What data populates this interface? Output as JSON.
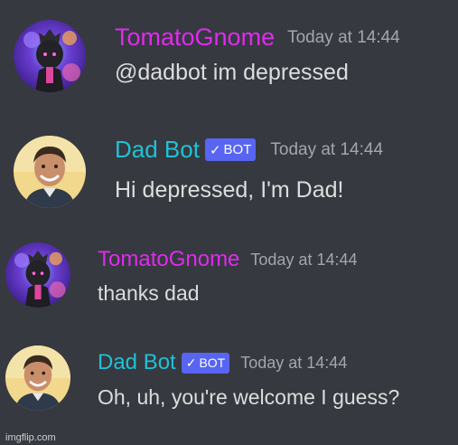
{
  "colors": {
    "background": "#36393f",
    "tomato_name": "#e02af0",
    "dadbot_name": "#1fc2d6",
    "bot_badge": "#5865f2",
    "timestamp": "#a3a6aa",
    "message_text": "#dcddde"
  },
  "messages": [
    {
      "author": "TomatoGnome",
      "timestamp": "Today at 14:44",
      "text": "@dadbot im depressed",
      "avatar_icon": "dark-character-avatar"
    },
    {
      "author": "Dad Bot",
      "badge": "BOT",
      "badge_icon": "checkmark-icon",
      "timestamp": "Today at 14:44",
      "text": "Hi depressed, I'm Dad!",
      "avatar_icon": "smiling-man-avatar"
    },
    {
      "author": "TomatoGnome",
      "timestamp": "Today at 14:44",
      "text": "thanks dad",
      "avatar_icon": "dark-character-avatar"
    },
    {
      "author": "Dad Bot",
      "badge": "BOT",
      "badge_icon": "checkmark-icon",
      "timestamp": "Today at 14:44",
      "text": "Oh, uh, you're welcome I guess?",
      "avatar_icon": "smiling-man-avatar"
    }
  ],
  "watermark": "imgflip.com"
}
